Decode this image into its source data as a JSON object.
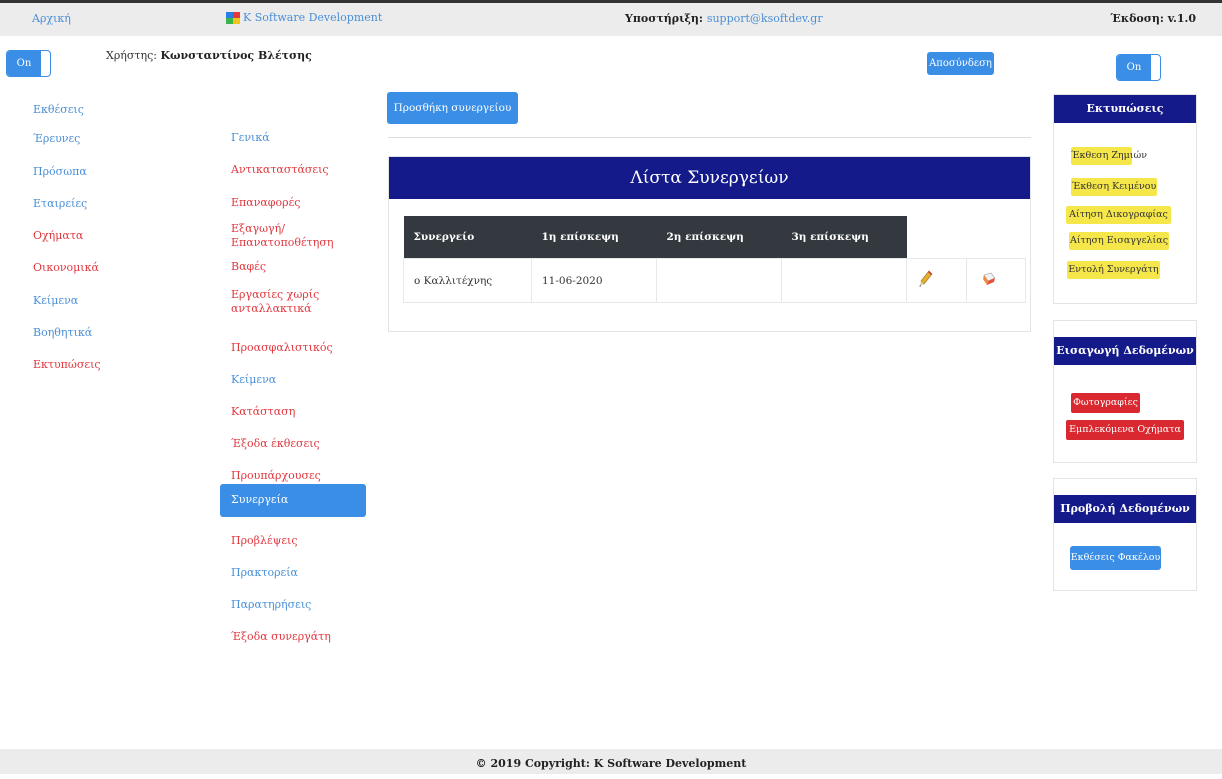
{
  "topbar": {
    "home": "Αρχική",
    "brand": "K Software Development",
    "support_label": "Υποστήριξη:",
    "support_email": "support@ksoftdev.gr",
    "version": "Έκδοση: v.1.0"
  },
  "toggles": {
    "left": "On",
    "right": "On"
  },
  "user": {
    "label": "Χρήστης:",
    "name": "Κωνσταντίνος Βλέτσης"
  },
  "logout": "Αποσύνδεση",
  "nav1": [
    "Εκθέσεις",
    "Έρευνες",
    "Πρόσωπα",
    "Εταιρείες",
    "Οχήματα",
    "Οικονομικά",
    "Κείμενα",
    "Βοηθητικά",
    "Εκτυπώσεις"
  ],
  "nav2": [
    "Γενικά",
    "Αντικαταστάσεις",
    "Επαναφορές",
    "Εξαγωγή/ Επανατοποθέτηση",
    "Βαφές",
    "Εργασίες χωρίς ανταλλακτικά",
    "Προασφαλιστικός",
    "Κείμενα",
    "Κατάσταση",
    "Έξοδα έκθεσεις",
    "Προυπάρχουσες",
    "Συνεργεία",
    "Προβλέψεις",
    "Πρακτορεία",
    "Παρατηρήσεις",
    "Έξοδα συνεργάτη"
  ],
  "add_button": "Προσθήκη συνεργείου",
  "card_title": "Λίστα Συνεργείων",
  "table": {
    "headers": [
      "Συνεργείο",
      "1η επίσκεψη",
      "2η επίσκεψη",
      "3η επίσκεψη"
    ],
    "rows": [
      {
        "name": "ο Καλλιτέχνης",
        "v1": "11-06-2020",
        "v2": "",
        "v3": ""
      }
    ]
  },
  "prints": {
    "title": "Εκτυπώσεις",
    "buttons": [
      "Έκθεση Ζημιών",
      "Έκθεση Κειμένου",
      "Αίτηση Δικογραφίας",
      "Αίτηση Εισαγγελίας",
      "Εντολή Συνεργάτη"
    ]
  },
  "data_entry": {
    "title": "Εισαγωγή Δεδομένων",
    "buttons": [
      "Φωτογραφίες",
      "Εμπλεκόμενα Οχήματα"
    ]
  },
  "data_view": {
    "title": "Προβολή Δεδομένων",
    "buttons": [
      "Εκθέσεις Φακέλου"
    ]
  },
  "footer": "© 2019 Copyright: K Software Development",
  "colors": {
    "nav_blue": "#4a8fd6",
    "nav_red": "#e0383f",
    "header_navy": "#141a8a",
    "button_blue": "#3a8ee6",
    "button_yellow": "#f5e64a",
    "button_red": "#d9282f"
  }
}
